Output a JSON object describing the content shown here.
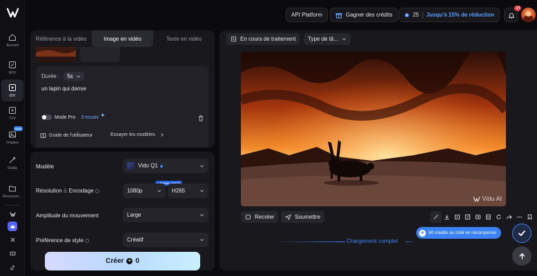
{
  "topbar": {
    "api_label": "API Platform",
    "credits_label": "Gagner des crédits",
    "promo_count": "25",
    "promo_text": "Jusqu'à 15% de réduction",
    "notif_count": "14"
  },
  "rail": {
    "items": [
      {
        "label": "Accueil"
      },
      {
        "label": "R2V"
      },
      {
        "label": "I2V"
      },
      {
        "label": "T2V"
      },
      {
        "label": "Images"
      },
      {
        "label": "Outils"
      },
      {
        "label": "Ressourc..."
      }
    ],
    "new_badge": "New"
  },
  "left": {
    "tabs": [
      "Référence à la vidéo",
      "Image en vidéo",
      "Texte en vidéo"
    ],
    "duration_label": "Durée :",
    "duration_value": "5s",
    "prompt": "un lapin qui danse",
    "mode_pro": "Mode Pro",
    "essais": "3 essais",
    "guide": "Guide de l'utilisateur",
    "try_models": "Essayer les modèles",
    "settings": {
      "model_label": "Modèle",
      "model_value": "Vidu Q1",
      "res_label": "Résolution",
      "res_amp": "&",
      "res_label2": "Encodage",
      "res_badge": "Essais gratuits",
      "res_value": "1080p",
      "enc_value": "H265",
      "motion_label": "Amplitude du mouvement",
      "motion_value": "Large",
      "style_label": "Préférence de style",
      "style_value": "Créatif"
    },
    "create_label": "Créer",
    "create_cost": "0"
  },
  "main": {
    "status_chip": "En cours de traitement",
    "type_chip": "Type de tâ...",
    "watermark": "Vidu AI",
    "recreate": "Recréer",
    "submit": "Soumettre",
    "loaded": "Chargement complet",
    "reward": "80 crédits au total en récompense"
  },
  "colors": {
    "accent": "#3b82f6",
    "panel": "#18181d",
    "background": "#0b0b0e"
  }
}
